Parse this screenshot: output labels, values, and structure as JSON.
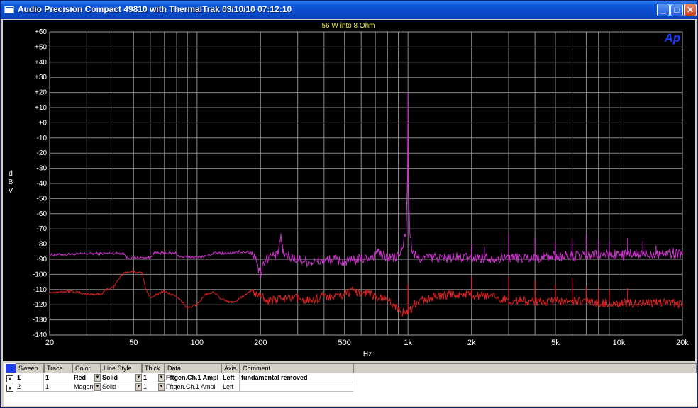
{
  "window": {
    "title": "Audio Precision  Compact 49810 with ThermalTrak  03/10/10 07:12:10",
    "buttons": {
      "minimize": "_",
      "maximize": "□",
      "close": "✕"
    }
  },
  "chart_data": {
    "type": "line",
    "title": "56 W into 8 Ohm",
    "logo": "Ap",
    "xlabel": "Hz",
    "ylabel": "d\nB\nV",
    "xscale": "log",
    "xlim": [
      20,
      20000
    ],
    "ylim": [
      -140,
      60
    ],
    "grid": true,
    "background": "#000000",
    "x_ticks": [
      {
        "v": 20,
        "label": "20"
      },
      {
        "v": 50,
        "label": "50"
      },
      {
        "v": 100,
        "label": "100"
      },
      {
        "v": 200,
        "label": "200"
      },
      {
        "v": 500,
        "label": "500"
      },
      {
        "v": 1000,
        "label": "1k"
      },
      {
        "v": 2000,
        "label": "2k"
      },
      {
        "v": 5000,
        "label": "5k"
      },
      {
        "v": 10000,
        "label": "10k"
      },
      {
        "v": 20000,
        "label": "20k"
      }
    ],
    "y_ticks": [
      {
        "v": 60,
        "label": "+60"
      },
      {
        "v": 50,
        "label": "+50"
      },
      {
        "v": 40,
        "label": "+40"
      },
      {
        "v": 30,
        "label": "+30"
      },
      {
        "v": 20,
        "label": "+20"
      },
      {
        "v": 10,
        "label": "+10"
      },
      {
        "v": 0,
        "label": "+0"
      },
      {
        "v": -10,
        "label": "-10"
      },
      {
        "v": -20,
        "label": "-20"
      },
      {
        "v": -30,
        "label": "-30"
      },
      {
        "v": -40,
        "label": "-40"
      },
      {
        "v": -50,
        "label": "-50"
      },
      {
        "v": -60,
        "label": "-60"
      },
      {
        "v": -70,
        "label": "-70"
      },
      {
        "v": -80,
        "label": "-80"
      },
      {
        "v": -90,
        "label": "-90"
      },
      {
        "v": -100,
        "label": "-100"
      },
      {
        "v": -110,
        "label": "-110"
      },
      {
        "v": -120,
        "label": "-120"
      },
      {
        "v": -130,
        "label": "-130"
      },
      {
        "v": -140,
        "label": "-140"
      }
    ],
    "series": [
      {
        "color": "#cc33cc",
        "points": [
          [
            20,
            -87
          ],
          [
            30,
            -86.5
          ],
          [
            40,
            -86
          ],
          [
            45,
            -86
          ],
          [
            46,
            -89
          ],
          [
            60,
            -89
          ],
          [
            62,
            -86
          ],
          [
            80,
            -86
          ],
          [
            82,
            -88.5
          ],
          [
            100,
            -88.5
          ],
          [
            110,
            -88
          ],
          [
            120,
            -86
          ],
          [
            150,
            -86
          ],
          [
            160,
            -85
          ],
          [
            180,
            -85.5
          ],
          [
            190,
            -88
          ],
          [
            195,
            -97
          ],
          [
            200,
            -100
          ],
          [
            205,
            -93
          ],
          [
            210,
            -91
          ],
          [
            220,
            -88
          ],
          [
            240,
            -88
          ],
          [
            250,
            -74
          ],
          [
            255,
            -86
          ],
          [
            270,
            -88
          ],
          [
            300,
            -90
          ],
          [
            350,
            -92
          ],
          [
            400,
            -91
          ],
          [
            450,
            -90
          ],
          [
            500,
            -92
          ],
          [
            550,
            -91
          ],
          [
            600,
            -90
          ],
          [
            650,
            -89
          ],
          [
            700,
            -87
          ],
          [
            720,
            -83
          ],
          [
            730,
            -87
          ],
          [
            800,
            -89
          ],
          [
            850,
            -89
          ],
          [
            900,
            -88
          ],
          [
            950,
            -81
          ],
          [
            980,
            -70
          ],
          [
            995,
            -40
          ],
          [
            1000,
            20
          ],
          [
            1005,
            -40
          ],
          [
            1020,
            -72
          ],
          [
            1050,
            -86
          ],
          [
            1100,
            -89
          ],
          [
            1200,
            -89
          ],
          [
            1500,
            -89
          ],
          [
            2000,
            -89
          ],
          [
            2500,
            -89
          ],
          [
            3000,
            -89
          ],
          [
            4000,
            -89
          ],
          [
            5000,
            -88
          ],
          [
            6000,
            -88
          ],
          [
            7000,
            -88
          ],
          [
            8000,
            -87
          ],
          [
            10000,
            -87
          ],
          [
            12000,
            -87
          ],
          [
            15000,
            -86
          ],
          [
            18000,
            -86
          ],
          [
            20000,
            -86
          ]
        ],
        "noise": 3.5,
        "spikes": [
          [
            2000,
            -80
          ],
          [
            2300,
            -82
          ],
          [
            3000,
            -73
          ],
          [
            4000,
            -76
          ],
          [
            5000,
            -79
          ],
          [
            6000,
            -77
          ],
          [
            7000,
            -74
          ],
          [
            8000,
            -77
          ],
          [
            9000,
            -78
          ],
          [
            11000,
            -76
          ],
          [
            13000,
            -78
          ],
          [
            15000,
            -81
          ]
        ]
      },
      {
        "color": "#dd2222",
        "points": [
          [
            20,
            -112
          ],
          [
            25,
            -111
          ],
          [
            30,
            -113
          ],
          [
            35,
            -113
          ],
          [
            37,
            -110
          ],
          [
            40,
            -109
          ],
          [
            42,
            -104
          ],
          [
            45,
            -99
          ],
          [
            50,
            -98
          ],
          [
            55,
            -99
          ],
          [
            57,
            -110
          ],
          [
            60,
            -115
          ],
          [
            70,
            -111
          ],
          [
            80,
            -115
          ],
          [
            85,
            -118
          ],
          [
            90,
            -122
          ],
          [
            100,
            -120
          ],
          [
            110,
            -113
          ],
          [
            120,
            -112
          ],
          [
            130,
            -116
          ],
          [
            140,
            -118
          ],
          [
            150,
            -118
          ],
          [
            160,
            -116
          ],
          [
            170,
            -113
          ],
          [
            180,
            -111
          ],
          [
            190,
            -113
          ],
          [
            200,
            -113
          ],
          [
            220,
            -118
          ],
          [
            250,
            -116
          ],
          [
            300,
            -116
          ],
          [
            350,
            -117
          ],
          [
            400,
            -114
          ],
          [
            450,
            -115
          ],
          [
            500,
            -113
          ],
          [
            550,
            -111
          ],
          [
            600,
            -112
          ],
          [
            650,
            -112
          ],
          [
            700,
            -115
          ],
          [
            800,
            -117
          ],
          [
            850,
            -120
          ],
          [
            900,
            -123
          ],
          [
            950,
            -125
          ],
          [
            1000,
            -125
          ],
          [
            1050,
            -122
          ],
          [
            1100,
            -118
          ],
          [
            1200,
            -117
          ],
          [
            1300,
            -115
          ],
          [
            1500,
            -114
          ],
          [
            1800,
            -113
          ],
          [
            2000,
            -114
          ],
          [
            2500,
            -115
          ],
          [
            3000,
            -117
          ],
          [
            4000,
            -118
          ],
          [
            5000,
            -118
          ],
          [
            6000,
            -118
          ],
          [
            7000,
            -118
          ],
          [
            8000,
            -119
          ],
          [
            10000,
            -119
          ],
          [
            12000,
            -119
          ],
          [
            15000,
            -119
          ],
          [
            18000,
            -119
          ],
          [
            20000,
            -120
          ]
        ],
        "noise": 3,
        "spikes": [
          [
            1000,
            -107
          ],
          [
            2000,
            -101
          ],
          [
            3000,
            -101
          ],
          [
            4000,
            -104
          ],
          [
            5000,
            -107
          ],
          [
            6000,
            -103
          ],
          [
            7000,
            -108
          ],
          [
            8000,
            -109
          ],
          [
            9000,
            -110
          ],
          [
            11000,
            -109
          ]
        ]
      }
    ]
  },
  "legend_table": {
    "headers": [
      "Sweep",
      "Trace",
      "Color",
      "Line Style",
      "Thick",
      "Data",
      "Axis",
      "Comment"
    ],
    "rows": [
      {
        "checked": "x",
        "sweep": "1",
        "trace": "1",
        "color": "Red",
        "style": "Solid",
        "thick": "1",
        "data": "Fftgen.Ch.1 Ampl",
        "axis": "Left",
        "comment": "fundamental removed",
        "bold": true
      },
      {
        "checked": "x",
        "sweep": "2",
        "trace": "1",
        "color": "Magenta",
        "style": "Solid",
        "thick": "1",
        "data": "Fftgen.Ch.1 Ampl",
        "axis": "Left",
        "comment": "",
        "bold": false
      }
    ]
  }
}
